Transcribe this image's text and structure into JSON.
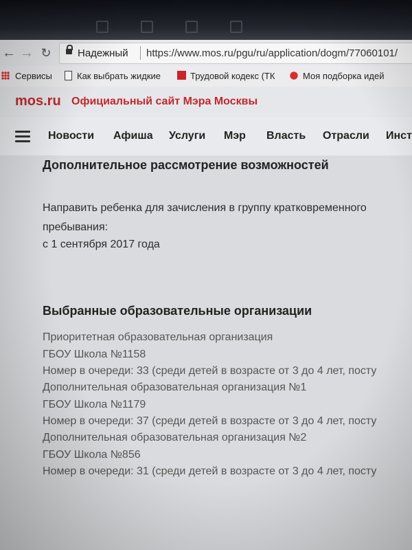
{
  "browser": {
    "secure_label": "Надежный",
    "url": "https://www.mos.ru/pgu/ru/application/dogm/77060101/",
    "bookmarks": [
      {
        "label": "Сервисы"
      },
      {
        "label": "Как выбрать жидкие"
      },
      {
        "label": "Трудовой кодекс (ТК"
      },
      {
        "label": "Моя подборка идей"
      }
    ]
  },
  "site": {
    "logo": "mos.ru",
    "title": "Официальный сайт Мэра Москвы",
    "nav": [
      "Новости",
      "Афиша",
      "Услуги",
      "Мэр",
      "Власть",
      "Отрасли",
      "Инст"
    ]
  },
  "content": {
    "section1_title": "Дополнительное рассмотрение возможностей",
    "section1_line1": "Направить ребенка для зачисления в группу кратковременного",
    "section1_line2": "пребывания:",
    "section1_line3": "с 1 сентября 2017 года",
    "section2_title": "Выбранные образовательные организации",
    "orgs": [
      {
        "label": "Приоритетная образовательная организация",
        "school": "ГБОУ Школа №1158",
        "queue": "Номер в очереди: 33 (среди детей в возрасте от 3 до 4 лет, посту"
      },
      {
        "label": "Дополнительная образовательная организация №1",
        "school": "ГБОУ Школа №1179",
        "queue": "Номер в очереди: 37 (среди детей в возрасте от 3 до 4 лет, посту"
      },
      {
        "label": "Дополнительная образовательная организация №2",
        "school": "ГБОУ Школа №856",
        "queue": "Номер в очереди: 31 (среди детей в возрасте от 3 до 4 лет, посту"
      }
    ]
  }
}
